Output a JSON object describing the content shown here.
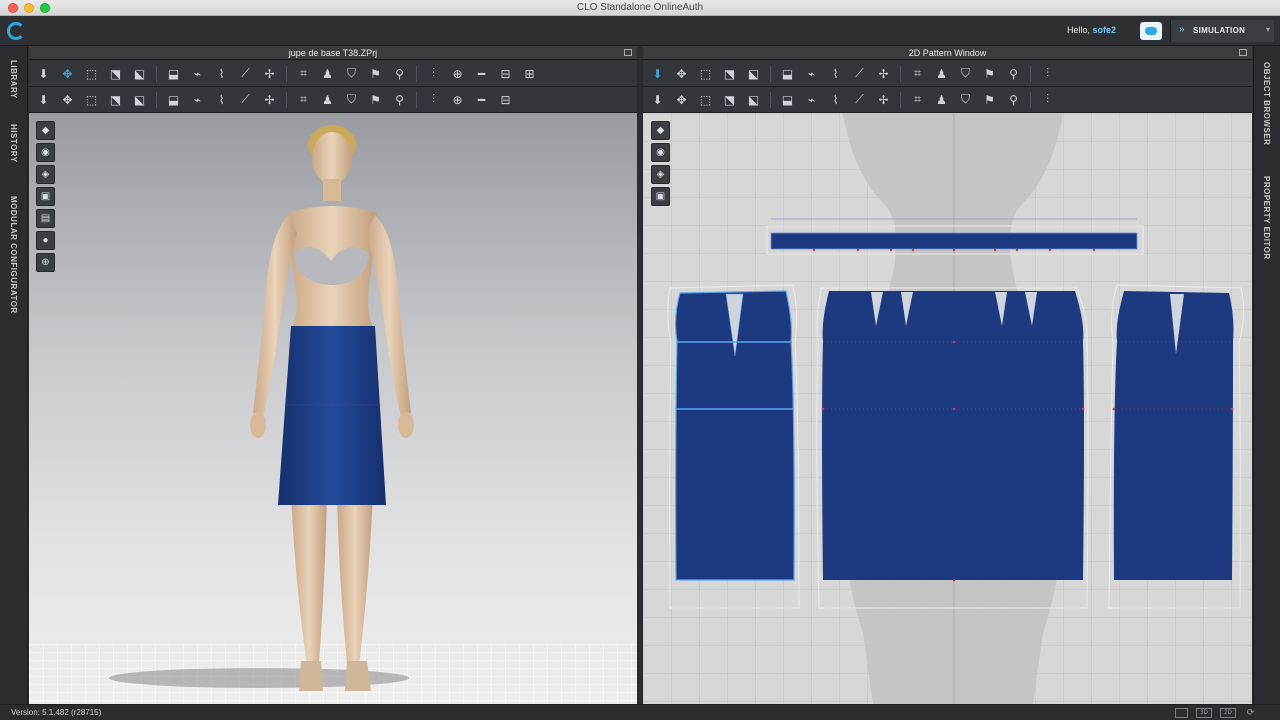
{
  "window": {
    "title": "CLO Standalone OnlineAuth"
  },
  "header": {
    "greeting": "Hello,",
    "username": "sofe2",
    "mode_button": "SIMULATION"
  },
  "left_tabs": [
    "LIBRARY",
    "HISTORY",
    "MODULAR CONFIGURATOR"
  ],
  "right_tabs": [
    "OBJECT BROWSER",
    "PROPERTY EDITOR"
  ],
  "panel_3d": {
    "title": "jupe de base T38.ZPrj"
  },
  "panel_2d": {
    "title": "2D Pattern Window"
  },
  "status": {
    "version": "Version: 5.1.482 (r28715)",
    "view_3d": "3D",
    "view_2d": "2D"
  },
  "colors": {
    "fabric": "#1d3a80",
    "accent": "#35a6e8",
    "seam_line": "#c23b3b",
    "chrome_dark": "#2b2d31"
  },
  "toolbar_3d_row1_icons": [
    "arrow-down-icon",
    "transform-pattern-icon",
    "select-mesh-icon",
    "transform-mesh-icon",
    "edit-pattern-icon",
    "internal-polygon-icon",
    "curve-point-icon",
    "edit-curvature-icon",
    "segment-sewing-icon",
    "tack-icon",
    "fold-arrangement-icon",
    "avatar-icon",
    "garment-fit-icon",
    "arrangement-point-icon",
    "pin-icon",
    "zipper-icon",
    "button-icon",
    "strap-icon",
    "fold-icon",
    "measure-icon"
  ],
  "toolbar_3d_row2_icons": [
    "pose-icon",
    "select-icon",
    "fold-3d-icon",
    "tape-icon",
    "puckering-icon",
    "pinning-icon",
    "fabric-icon",
    "texture-icon",
    "topstitch-icon",
    "trim-icon",
    "graphic-icon",
    "line-icon",
    "zipper-pull-icon",
    "seam-taping-icon",
    "bonding-icon",
    "skived-icon",
    "gradient-icon",
    "avatar-measure-icon",
    "shirring-icon"
  ],
  "toolbar_2d_row1_icons": [
    "edit-pattern-2d-icon",
    "transform-pattern-2d-icon",
    "edit-point-icon",
    "edit-curve-icon",
    "add-point-icon",
    "smart-pattern-icon",
    "internal-shape-icon",
    "rectangle-icon",
    "polygon-icon",
    "dart-icon",
    "notch-icon",
    "fold-2d-icon",
    "binding-icon",
    "sewing-icon",
    "segment-icon",
    "text-icon"
  ],
  "toolbar_2d_row2_icons": [
    "trace-icon",
    "gather-icon",
    "freeform-icon",
    "clone-icon",
    "iron-icon",
    "shirt-icon",
    "pattern-bulk-icon",
    "grid-icon",
    "check-icon",
    "measure-2d-icon",
    "length-icon",
    "wave-icon",
    "curve-length-icon",
    "annotation-icon",
    "elastic-icon",
    "stitch-icon"
  ],
  "side_tools_3d": [
    "garment-display-icon",
    "avatar-display-icon",
    "fabric-display-icon",
    "texture-display-icon",
    "mesh-display-icon",
    "skin-display-icon",
    "environment-icon"
  ],
  "side_tools_2d": [
    "pattern-display-icon",
    "garment-2d-display-icon",
    "info-display-icon",
    "texture-2d-display-icon"
  ]
}
